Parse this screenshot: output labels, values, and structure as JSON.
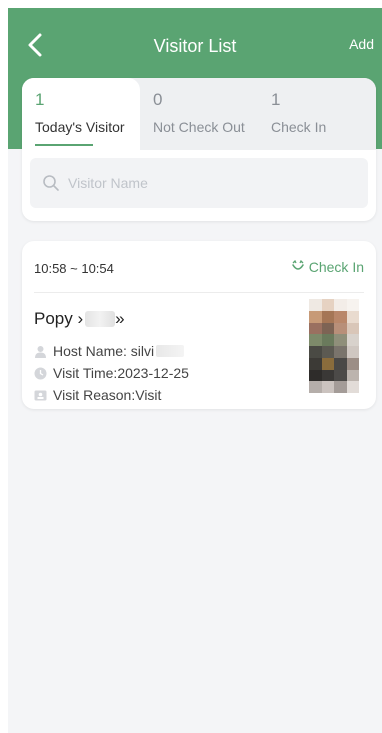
{
  "header": {
    "title": "Visitor List",
    "add_label": "Add"
  },
  "tabs": [
    {
      "count": "1",
      "label": "Today's Visitor",
      "active": true
    },
    {
      "count": "0",
      "label": "Not Check Out",
      "active": false
    },
    {
      "count": "1",
      "label": "Check In",
      "active": false
    }
  ],
  "search": {
    "placeholder": "Visitor Name"
  },
  "visitor": {
    "time_range": "10:58 ~ 10:54",
    "status": "Check In",
    "name": "Popy ›",
    "name_tail": "»",
    "host": "Host Name:  silvi",
    "visit_time": "Visit Time:2023-12-25",
    "visit_reason": "Visit Reason:Visit"
  },
  "colors": {
    "accent": "#5aa472",
    "background": "#f4f5f7",
    "card": "#ffffff"
  },
  "icons": {
    "back": "chevron-left-icon",
    "search": "search-icon",
    "status": "check-in-icon",
    "host": "person-icon",
    "time": "clock-icon",
    "reason": "id-card-icon"
  }
}
